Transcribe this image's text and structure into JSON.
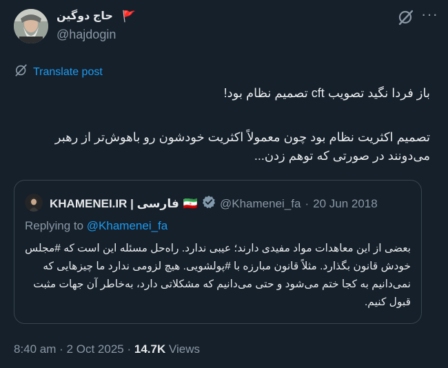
{
  "tweet": {
    "display_name": "حاج دوگین",
    "flag_emoji": "🚩",
    "handle": "@hajdogin",
    "translate_label": "Translate post",
    "text_line1": "باز فردا نگید تصویب cft تصمیم نظام بود!",
    "text_para2": "تصمیم اکثریت نظام بود چون معمولاً اکثریت خودشون رو باهوش‌تر از رهبر می‌دونند در صورتی که توهم زدن...",
    "time": "8:40 am",
    "date": "2 Oct 2025",
    "views_count": "14.7K",
    "views_label": "Views",
    "sep": "·"
  },
  "quote": {
    "name": "KHAMENEI.IR | فارسی",
    "flag": "🇮🇷",
    "handle": "@Khamenei_fa",
    "sep": "·",
    "date": "20 Jun 2018",
    "replying_prefix": "Replying to",
    "replying_handle": "@Khamenei_fa",
    "text": "بعضی از این معاهدات مواد مفیدی دارند؛ عیبی ندارد. راه‌حل مسئله این است که #مجلس خودش قانون بگذارد. مثلاً قانون مبارزه با #پولشویی. هیچ لزومی ندارد ما چیزهایی که نمی‌دانیم به کجا ختم می‌شود و حتی می‌دانیم که مشکلاتی دارد، به‌خاطر آن جهات مثبت قبول کنیم."
  },
  "colors": {
    "background": "#15202b",
    "text": "#e7e9ea",
    "secondary": "#8b98a5",
    "accent": "#1d9bf0",
    "border": "#38444d",
    "verified": "#829aab"
  },
  "icons": [
    "grok-icon",
    "more-icon",
    "translate-icon",
    "verified-badge-icon"
  ]
}
